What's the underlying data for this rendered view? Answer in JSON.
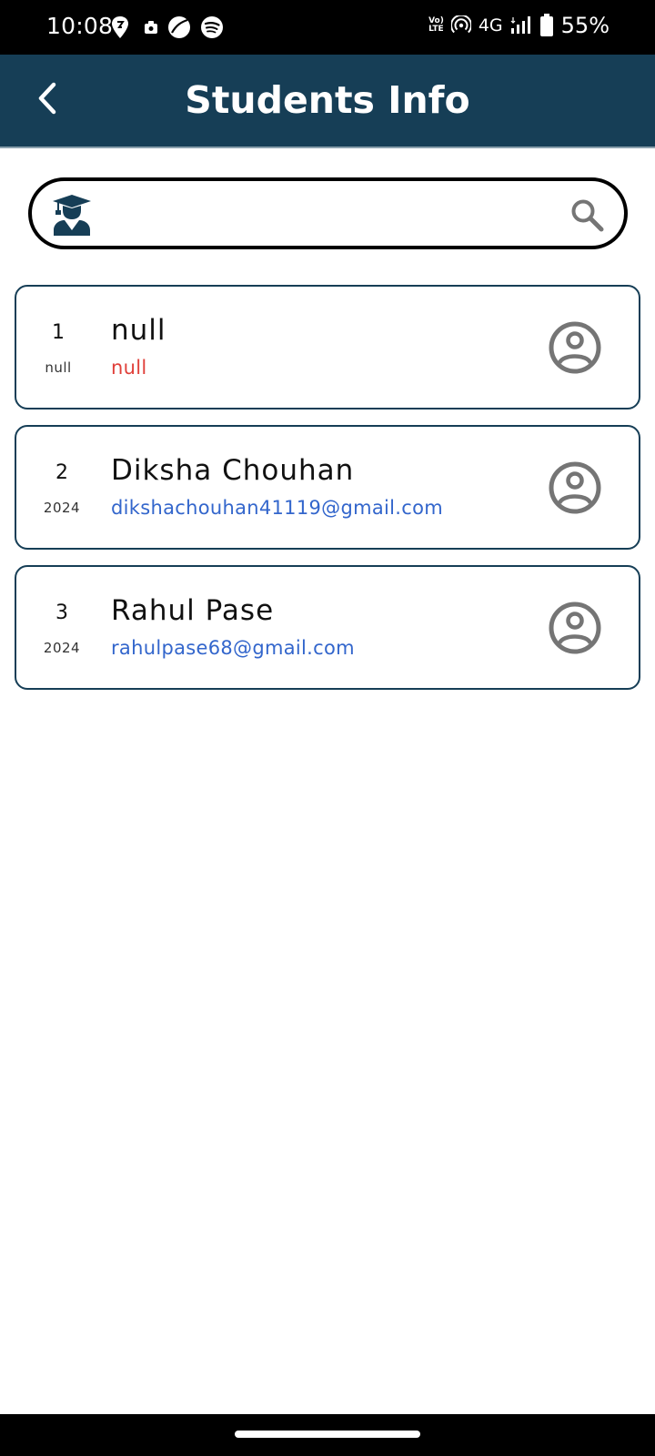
{
  "status_bar": {
    "time": "10:08",
    "network_type": "4G",
    "volte_top": "Vo)",
    "volte_bottom": "LTE",
    "battery_percent": "55%"
  },
  "app_bar": {
    "title": "Students Info"
  },
  "search": {
    "placeholder": "",
    "value": ""
  },
  "students": [
    {
      "number": "1",
      "year": "null",
      "name": "null",
      "email": "null",
      "email_color": "#e0403a"
    },
    {
      "number": "2",
      "year": "2024",
      "name": "Diksha Chouhan",
      "email": "dikshachouhan41119@gmail.com",
      "email_color": "#3366cc"
    },
    {
      "number": "3",
      "year": "2024",
      "name": "Rahul Pase",
      "email": "rahulpase68@gmail.com",
      "email_color": "#3366cc"
    }
  ],
  "theme": {
    "app_bar_color": "#163e56",
    "accent_text": "#3366cc",
    "error_text": "#e0403a",
    "icon_gray": "#757575"
  },
  "icons": {
    "back": "back-arrow-icon",
    "search_leading": "student-graduate-icon",
    "search_trailing": "search-icon",
    "avatar": "account-circle-icon"
  }
}
